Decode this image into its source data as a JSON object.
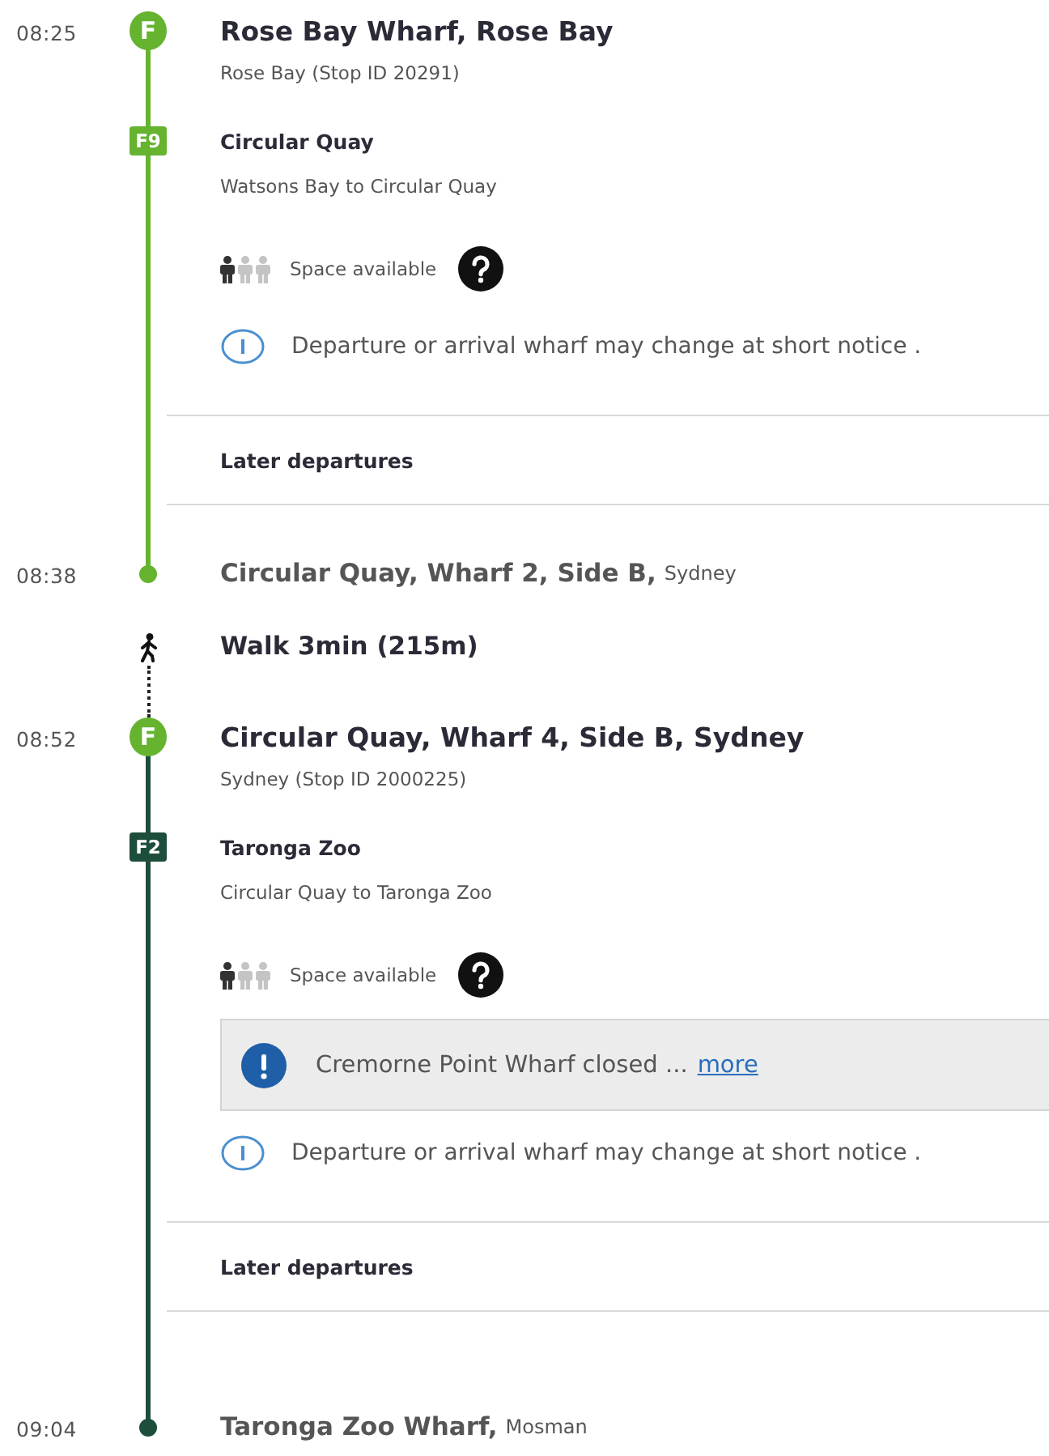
{
  "journey": [
    {
      "kind": "ferry",
      "color": "#65b32e",
      "departure": {
        "time": "08:25",
        "mode": "F",
        "name": "Rose Bay Wharf, Rose Bay",
        "detail": "Rose Bay (Stop ID 20291)"
      },
      "route": {
        "code": "F9",
        "name": "Circular Quay",
        "description": "Watsons Bay to Circular Quay"
      },
      "occupancy": {
        "figures": [
          {
            "filled": true
          },
          {
            "filled": false
          },
          {
            "filled": false
          }
        ],
        "label": "Space available"
      },
      "notice": "Departure or arrival wharf may change at short notice .",
      "later_departures": "Later departures",
      "arrival": {
        "time": "08:38",
        "name": "Circular Quay, Wharf 2, Side B,",
        "suburb": "Sydney"
      }
    },
    {
      "kind": "walk",
      "text": "Walk 3min (215m)"
    },
    {
      "kind": "ferry",
      "color": "#1d4d3b",
      "departure": {
        "time": "08:52",
        "mode": "F",
        "name": "Circular Quay, Wharf 4, Side B, Sydney",
        "detail": "Sydney (Stop ID 2000225)"
      },
      "route": {
        "code": "F2",
        "name": "Taronga Zoo",
        "description": "Circular Quay to Taronga Zoo"
      },
      "occupancy": {
        "figures": [
          {
            "filled": true
          },
          {
            "filled": false
          },
          {
            "filled": false
          }
        ],
        "label": "Space available"
      },
      "alerts": [
        {
          "text": "Cremorne Point Wharf closed ...",
          "link": "more"
        }
      ],
      "notice": "Departure or arrival wharf may change at short notice .",
      "later_departures": "Later departures",
      "arrival": {
        "time": "09:04",
        "name": "Taronga Zoo Wharf,",
        "suburb": "Mosman"
      }
    }
  ]
}
